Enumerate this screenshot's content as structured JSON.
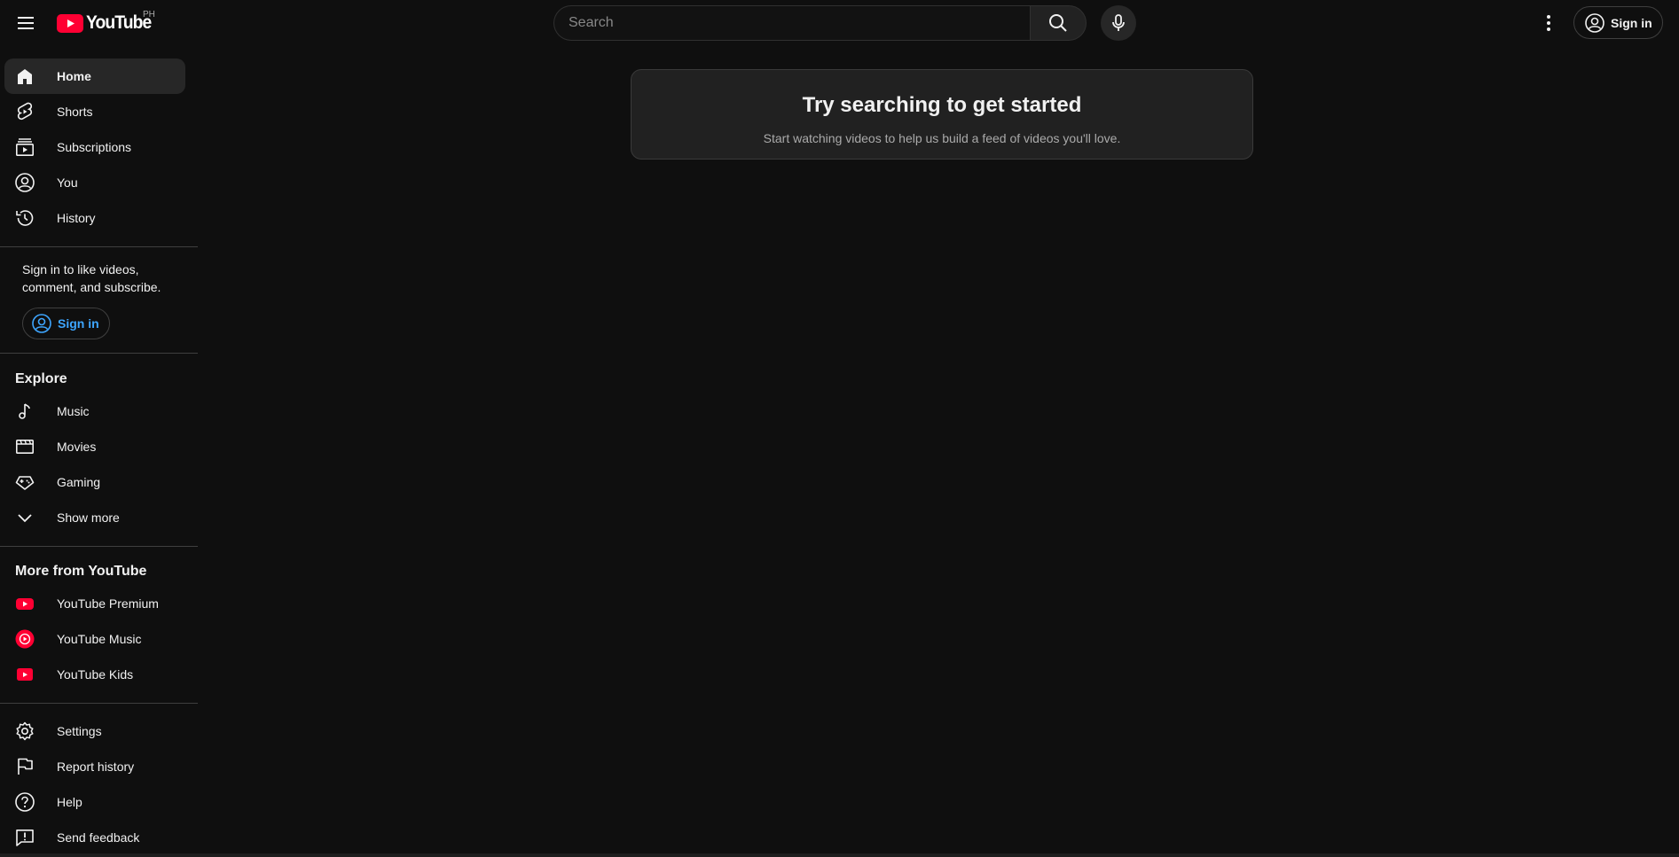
{
  "header": {
    "logo_text": "YouTube",
    "country_code": "PH",
    "search_placeholder": "Search",
    "sign_in_label": "Sign in"
  },
  "sidebar": {
    "primary": [
      {
        "label": "Home",
        "icon": "home-icon",
        "active": true
      },
      {
        "label": "Shorts",
        "icon": "shorts-icon"
      },
      {
        "label": "Subscriptions",
        "icon": "subscriptions-icon"
      },
      {
        "label": "You",
        "icon": "you-icon"
      },
      {
        "label": "History",
        "icon": "history-icon"
      }
    ],
    "signin_prompt": "Sign in to like videos, comment, and subscribe.",
    "signin_label": "Sign in",
    "explore_title": "Explore",
    "explore": [
      {
        "label": "Music",
        "icon": "music-icon"
      },
      {
        "label": "Movies",
        "icon": "movies-icon"
      },
      {
        "label": "Gaming",
        "icon": "gaming-icon"
      },
      {
        "label": "Show more",
        "icon": "chevron-down-icon"
      }
    ],
    "more_title": "More from YouTube",
    "more": [
      {
        "label": "YouTube Premium",
        "icon": "youtube-premium-icon"
      },
      {
        "label": "YouTube Music",
        "icon": "youtube-music-icon"
      },
      {
        "label": "YouTube Kids",
        "icon": "youtube-kids-icon"
      }
    ],
    "footer": [
      {
        "label": "Settings",
        "icon": "gear-icon"
      },
      {
        "label": "Report history",
        "icon": "flag-icon"
      },
      {
        "label": "Help",
        "icon": "help-icon"
      },
      {
        "label": "Send feedback",
        "icon": "feedback-icon"
      }
    ]
  },
  "main": {
    "empty_title": "Try searching to get started",
    "empty_subtitle": "Start watching videos to help us build a feed of videos you'll love."
  },
  "colors": {
    "background": "#0f0f0f",
    "brand_red": "#ff0033",
    "link_blue": "#3ea6ff",
    "active_bg": "#272727"
  }
}
